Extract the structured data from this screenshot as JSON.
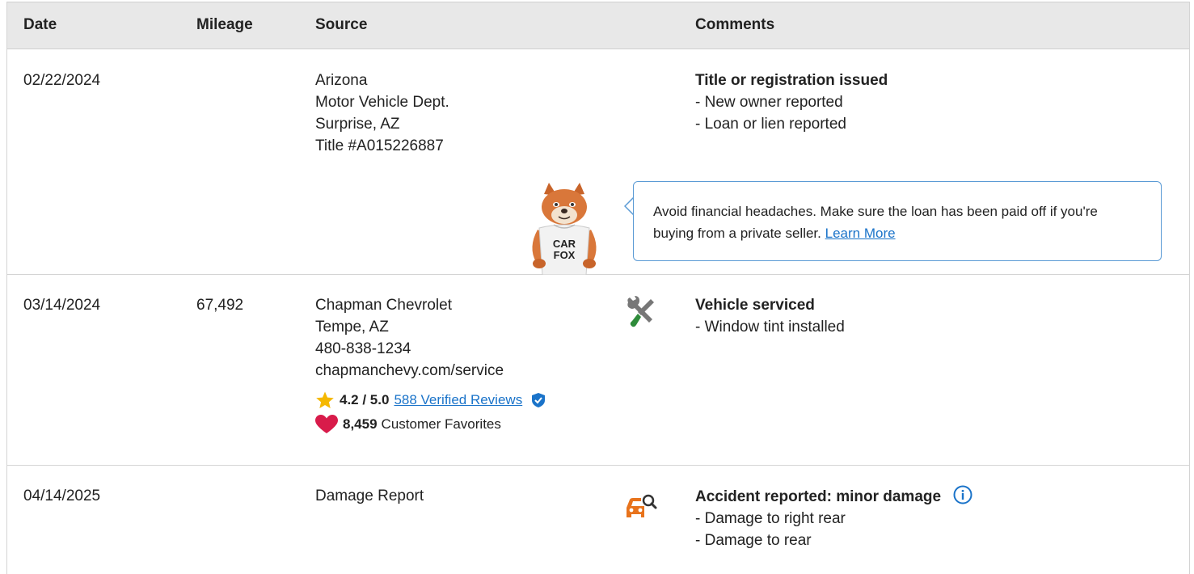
{
  "header": {
    "date": "Date",
    "mileage": "Mileage",
    "source": "Source",
    "comments": "Comments"
  },
  "rows": [
    {
      "date": "02/22/2024",
      "mileage": "",
      "source": [
        "Arizona",
        "Motor Vehicle Dept.",
        "Surprise, AZ",
        "Title #A015226887"
      ],
      "comment_title": "Title or registration issued",
      "comment_items": [
        "- New owner reported",
        "- Loan or lien reported"
      ],
      "tip": {
        "text": "Avoid financial headaches. Make sure the loan has been paid off if you're buying from a private seller.",
        "link": "Learn More",
        "mascot_shirt": [
          "CAR",
          "FOX"
        ]
      }
    },
    {
      "date": "03/14/2024",
      "mileage": "67,492",
      "source": [
        "Chapman Chevrolet",
        "Tempe, AZ",
        "480-838-1234",
        "chapmanchevy.com/service"
      ],
      "rating": "4.2 / 5.0",
      "reviews_link": "588 Verified Reviews",
      "favorites_count": "8,459",
      "favorites_label": "Customer Favorites",
      "icon": "wrench-screwdriver-icon",
      "comment_title": "Vehicle serviced",
      "comment_items": [
        "- Window tint installed"
      ]
    },
    {
      "date": "04/14/2025",
      "mileage": "",
      "source": [
        "Damage Report"
      ],
      "icon": "car-damage-search-icon",
      "comment_title": "Accident reported: minor damage",
      "comment_items": [
        "- Damage to right rear",
        "- Damage to rear"
      ]
    }
  ],
  "colors": {
    "header_bg": "#e8e8e8",
    "link": "#1a73c9",
    "star": "#f5b800",
    "heart": "#d81b4a",
    "service_green": "#2e8b3a",
    "damage_orange": "#e8731c",
    "bubble_border": "#5b9bd5"
  }
}
